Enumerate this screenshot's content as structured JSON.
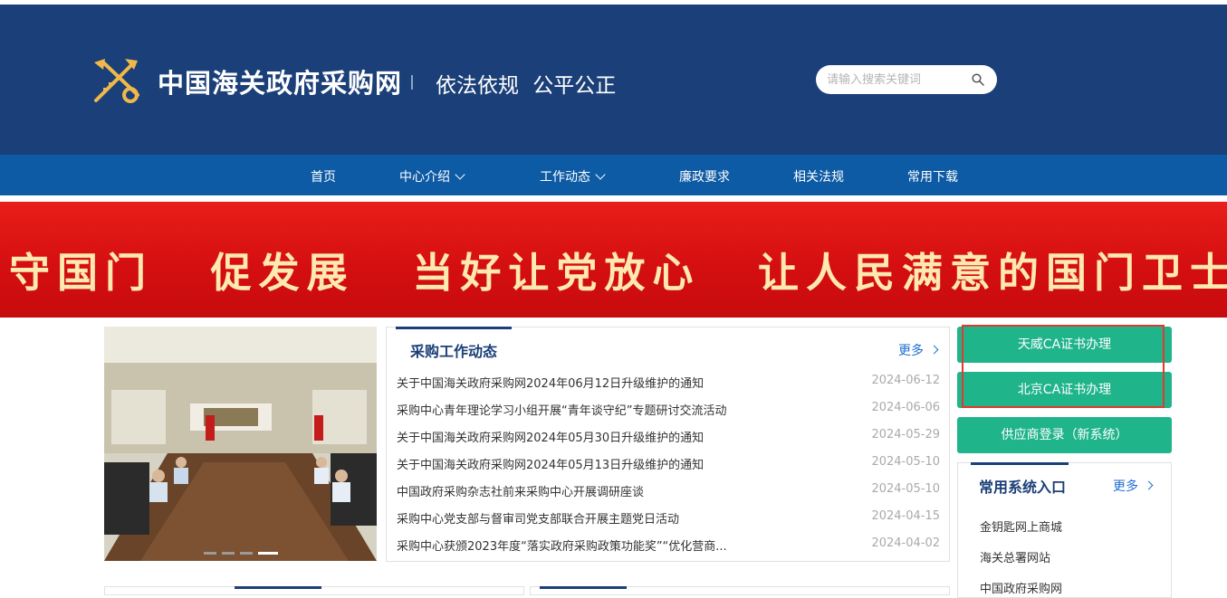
{
  "header": {
    "site_title": "中国海关政府采购网",
    "slogan": "依法依规  公平公正",
    "search_placeholder": "请输入搜索关键词",
    "logo_icon": "customs-emblem-icon"
  },
  "nav": {
    "items": [
      {
        "label": "首页",
        "dropdown": false
      },
      {
        "label": "中心介绍",
        "dropdown": true
      },
      {
        "label": "工作动态",
        "dropdown": true
      },
      {
        "label": "廉政要求",
        "dropdown": false
      },
      {
        "label": "相关法规",
        "dropdown": false
      },
      {
        "label": "常用下载",
        "dropdown": false
      }
    ]
  },
  "banner": {
    "text": "守国门 促发展 当好让党放心 让人民满意的国门卫士"
  },
  "news": {
    "title": "采购工作动态",
    "more": "更多",
    "items": [
      {
        "title": "关于中国海关政府采购网2024年06月12日升级维护的通知",
        "date": "2024-06-12"
      },
      {
        "title": "采购中心青年理论学习小组开展“青年谈守纪”专题研讨交流活动",
        "date": "2024-06-06"
      },
      {
        "title": "关于中国海关政府采购网2024年05月30日升级维护的通知",
        "date": "2024-05-29"
      },
      {
        "title": "关于中国海关政府采购网2024年05月13日升级维护的通知",
        "date": "2024-05-10"
      },
      {
        "title": "中国政府采购杂志社前来采购中心开展调研座谈",
        "date": "2024-05-10"
      },
      {
        "title": "采购中心党支部与督审司党支部联合开展主题党日活动",
        "date": "2024-04-15"
      },
      {
        "title": "采购中心获颁2023年度“落实政府采购政策功能奖”“优化营商...",
        "date": "2024-04-02"
      }
    ]
  },
  "buttons": {
    "tianwei_ca": "天威CA证书办理",
    "beijing_ca": "北京CA证书办理",
    "supplier_login": "供应商登录（新系统）"
  },
  "systems": {
    "title": "常用系统入口",
    "more": "更多",
    "links": [
      "金钥匙网上商城",
      "海关总署网站",
      "中国政府采购网"
    ]
  },
  "colors": {
    "header_bg": "#1b3f78",
    "nav_bg": "#0d5aa5",
    "banner_red": "#d50f10",
    "banner_text": "#ffe9b0",
    "button_green": "#20b48b",
    "link_blue": "#1f6fcf",
    "highlight_outline": "#e23a30"
  }
}
